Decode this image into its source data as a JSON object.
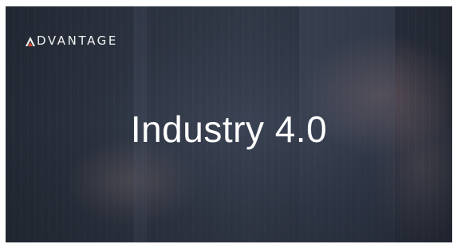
{
  "logo": {
    "text": "DVANTAGE",
    "full_name": "ADVANTAGE",
    "accent_color": "#e24a2b"
  },
  "headline": "Industry 4.0",
  "colors": {
    "background": "#2f3646",
    "text": "#ffffff"
  }
}
